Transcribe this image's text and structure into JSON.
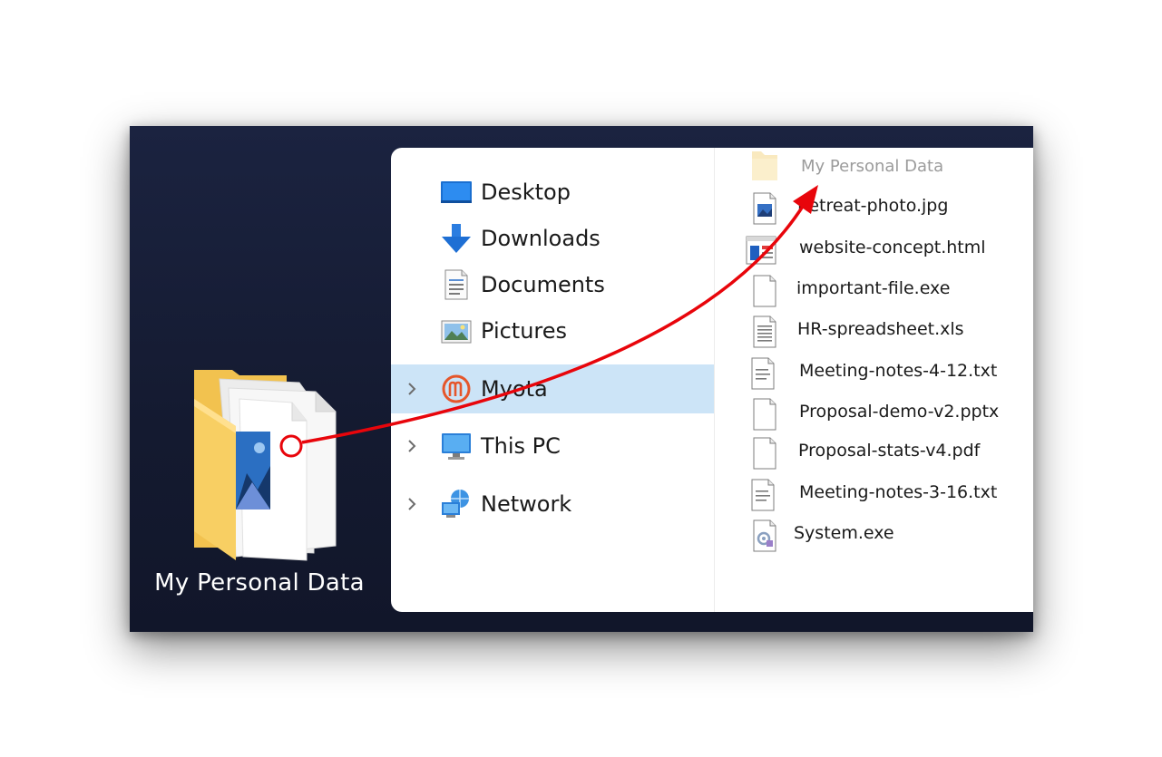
{
  "desktop": {
    "folder_label": "My Personal Data",
    "folder_icon": "folder-with-pictures-icon"
  },
  "explorer": {
    "nav_items": [
      {
        "label": "Desktop",
        "icon": "desktop-icon"
      },
      {
        "label": "Downloads",
        "icon": "download-arrow-icon"
      },
      {
        "label": "Documents",
        "icon": "document-icon"
      },
      {
        "label": "Pictures",
        "icon": "pictures-icon"
      },
      {
        "label": "Myota",
        "icon": "myota-logo-icon",
        "selected": true,
        "expandable": true
      },
      {
        "label": "This PC",
        "icon": "computer-icon",
        "expandable": true
      },
      {
        "label": "Network",
        "icon": "network-icon",
        "expandable": true
      }
    ],
    "files": [
      {
        "name": "My Personal Data",
        "icon": "folder-icon",
        "ghost": true
      },
      {
        "name": "Retreat-photo.jpg",
        "icon": "image-file-icon"
      },
      {
        "name": "website-concept.html",
        "icon": "html-file-icon"
      },
      {
        "name": "important-file.exe",
        "icon": "blank-file-icon"
      },
      {
        "name": "HR-spreadsheet.xls",
        "icon": "text-file-icon"
      },
      {
        "name": "Meeting-notes-4-12.txt",
        "icon": "text-file-icon"
      },
      {
        "name": "Proposal-demo-v2.pptx",
        "icon": "blank-file-icon"
      },
      {
        "name": "Proposal-stats-v4.pdf",
        "icon": "blank-file-icon"
      },
      {
        "name": "Meeting-notes-3-16.txt",
        "icon": "text-file-icon"
      },
      {
        "name": "System.exe",
        "icon": "system-file-icon"
      }
    ]
  },
  "colors": {
    "desktop_bg": "#161c33",
    "selection": "#cce4f7",
    "arrow": "#e8050b",
    "ghost_text": "#9b9b9b"
  }
}
